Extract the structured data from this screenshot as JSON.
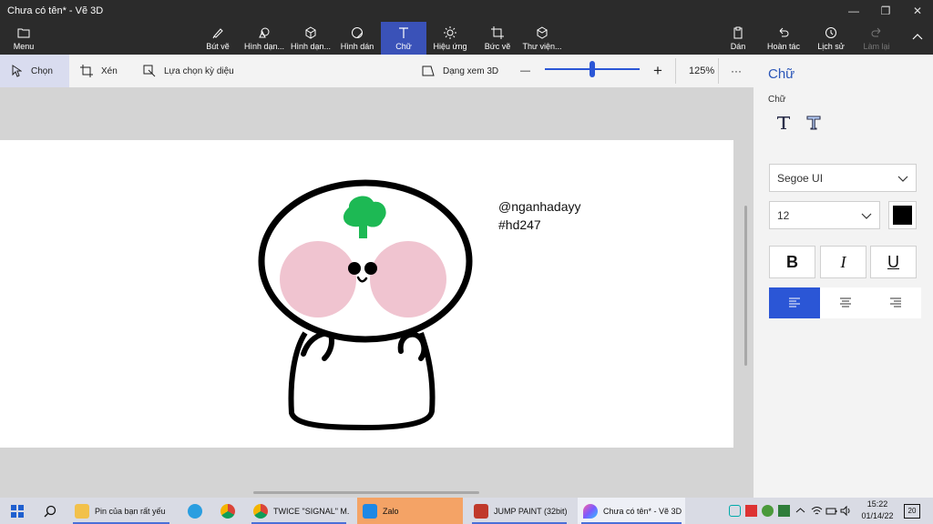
{
  "window": {
    "title": "Chưa có tên* - Vẽ 3D",
    "minimize": "—",
    "maximize": "❐",
    "close": "✕"
  },
  "ribbon": {
    "menu": "Menu",
    "tools": [
      "Bút vẽ",
      "Hình dạn...",
      "Hình dạn...",
      "Hình dán",
      "Chữ",
      "Hiệu ứng",
      "Bức vẽ",
      "Thư viện..."
    ],
    "right": [
      "Dán",
      "Hoàn tác",
      "Lịch sử",
      "Làm lại"
    ]
  },
  "toolbar": {
    "select": "Chọn",
    "crop": "Xén",
    "magic_select": "Lựa chọn kỳ diệu",
    "view_3d": "Dạng xem 3D",
    "zoom_minus": "—",
    "zoom_plus": "+",
    "zoom_level": "125%",
    "more": "···",
    "zoom_fraction": 0.5
  },
  "canvas": {
    "line1": "@nganhadayy",
    "line2": "#hd247"
  },
  "panel": {
    "title": "Chữ",
    "subtitle": "Chữ",
    "font": "Segoe UI",
    "size": "12",
    "color": "#000000",
    "bold": "B",
    "italic": "I",
    "underline": "U"
  },
  "taskbar": {
    "items": [
      "Pin của bạn rất yếu",
      "TWICE \"SIGNAL\" M...",
      "Zalo",
      "JUMP PAINT (32bit)",
      "Chưa có tên* - Vẽ 3D"
    ],
    "time": "15:22",
    "date": "01/14/22",
    "notifications": "20"
  },
  "colors": {
    "accent": "#2b56d6",
    "ribbon_bg": "#2b2b2b",
    "taskbar_active": "#f4a366",
    "leaf": "#1db954",
    "cheek": "#f0c4d0"
  }
}
